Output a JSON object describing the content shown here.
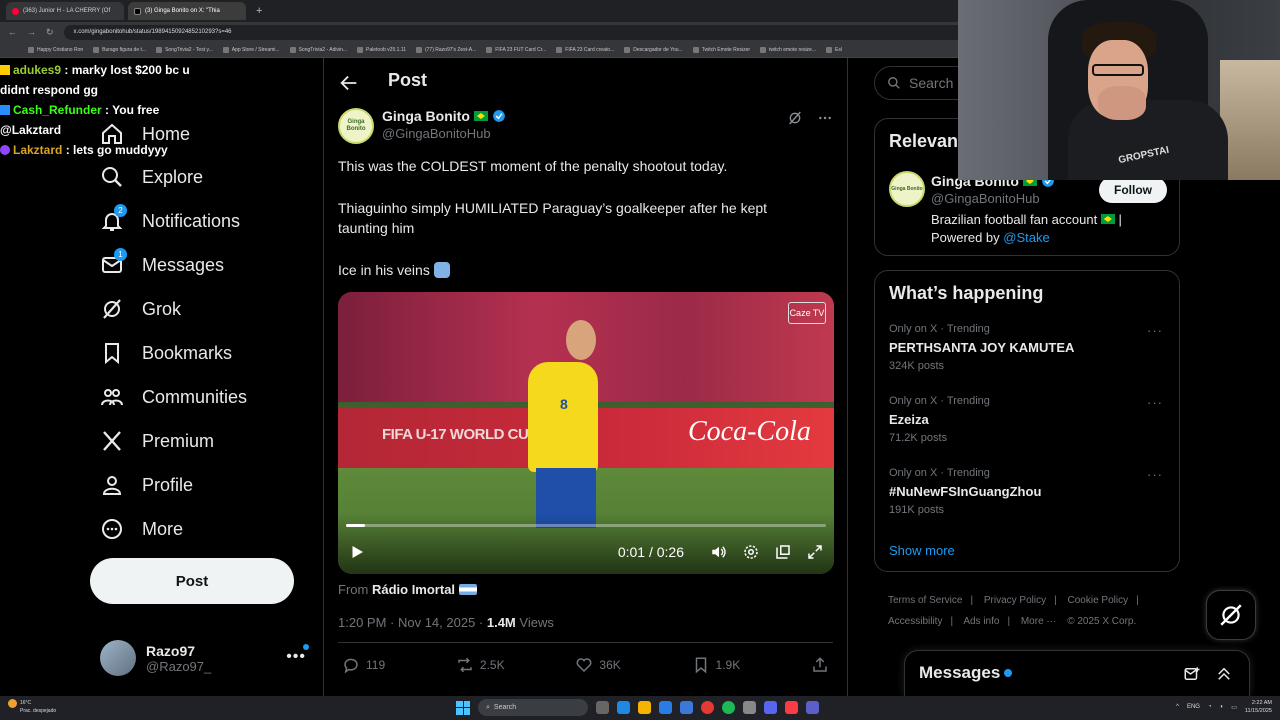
{
  "browser": {
    "tabs": [
      {
        "label": "(363) Junior H - LA CHERRY (Of"
      },
      {
        "label": "(3) Ginga Bonito on X: \"Thia"
      }
    ],
    "new_tab": "+",
    "url": "x.com/gingabonitohub/status/1989415092485210293?s=46",
    "bookmarks": [
      "Happy Cristiano Ron",
      "Burago figura de t...",
      "SongTrivia2 - Test y...",
      "App Store / Streami...",
      "SongTrivia2 - Adivin...",
      "Paletoob v25.1.11",
      "(77) Razo97's Zest-A...",
      "FIFA 23 FUT Card Cr...",
      "FIFA 23 Card creato...",
      "Descargador de You...",
      "Twitch Emote Resizer",
      "twitch emote resize...",
      "Esl"
    ]
  },
  "chat": [
    {
      "user": "adukes9",
      "msg": ": marky lost $200 bc u didnt respond gg"
    },
    {
      "user": "Cash_Refunder",
      "msg": ": You free @Lakztard"
    },
    {
      "user": "Lakztard",
      "msg": ": lets go muddyyy"
    }
  ],
  "sidebar": {
    "items": [
      {
        "label": "Home",
        "icon": "home-icon"
      },
      {
        "label": "Explore",
        "icon": "search-icon"
      },
      {
        "label": "Notifications",
        "icon": "bell-icon",
        "badge": "2"
      },
      {
        "label": "Messages",
        "icon": "envelope-icon",
        "badge": "1"
      },
      {
        "label": "Grok",
        "icon": "grok-icon"
      },
      {
        "label": "Bookmarks",
        "icon": "bookmark-icon"
      },
      {
        "label": "Communities",
        "icon": "communities-icon"
      },
      {
        "label": "Premium",
        "icon": "x-logo-icon"
      },
      {
        "label": "Profile",
        "icon": "person-icon"
      },
      {
        "label": "More",
        "icon": "more-circle-icon"
      }
    ],
    "post_label": "Post",
    "account": {
      "name": "Razo97",
      "handle": "@Razo97_",
      "more": "•••"
    }
  },
  "post": {
    "header_title": "Post",
    "author_name": "Ginga Bonito",
    "author_handle": "@GingaBonitoHub",
    "avatar_text": "Ginga Bonito",
    "text_1": "This was the COLDEST moment of the penalty shootout today.",
    "text_2": "Thiaguinho simply HUMILIATED Paraguay’s goalkeeper after he kept taunting him",
    "text_3": "Ice in his veins",
    "video": {
      "board_text": "FIFA U-17 WORLD CUP Q",
      "sponsor": "Coca-Cola",
      "shirt_number": "8",
      "logo": "Caze TV",
      "time": "0:01 / 0:26",
      "progress": 0.04
    },
    "from_prefix": "From",
    "from_source": "Rádio Imortal",
    "time": "1:20 PM · Nov 14, 2025 · ",
    "views_count": "1.4M",
    "views_label": "Views",
    "stats": {
      "replies": "119",
      "reposts": "2.5K",
      "likes": "36K",
      "bookmarks": "1.9K"
    }
  },
  "right": {
    "search_placeholder": "Search",
    "relevant_title": "Relevant",
    "relevant": {
      "name": "Ginga Bonito",
      "handle": "@GingaBonitoHub",
      "bio_1": "Brazilian football fan account",
      "bio_2": "Powered by",
      "bio_link": "@Stake",
      "follow": "Follow",
      "bio_sep": "|"
    },
    "happening_title": "What’s happening",
    "trends": [
      {
        "meta": "Only on X · Trending",
        "title": "PERTHSANTA JOY KAMUTEA",
        "count": "324K posts"
      },
      {
        "meta": "Only on X · Trending",
        "title": "Ezeiza",
        "count": "71.2K posts"
      },
      {
        "meta": "Only on X · Trending",
        "title": "#NuNewFSInGuangZhou",
        "count": "191K posts"
      }
    ],
    "show_more": "Show more",
    "footer": [
      "Terms of Service",
      "|",
      "Privacy Policy",
      "|",
      "Cookie Policy",
      "|",
      "Accessibility",
      "|",
      "Ads info",
      "|",
      "More ···",
      "© 2025 X Corp."
    ],
    "messages_title": "Messages"
  },
  "webcam": {
    "shirt_text": "GROPSTAI"
  },
  "taskbar": {
    "weather_temp": "16°C",
    "weather_desc": "Prac. despejado",
    "search": "Search",
    "lang": "ENG",
    "time": "2:22 AM",
    "date": "11/15/2025"
  },
  "colors": {
    "accent": "#1d9bf0",
    "bg": "#000000",
    "text": "#e7e9ea",
    "muted": "#71767b",
    "border": "#2f3336"
  }
}
